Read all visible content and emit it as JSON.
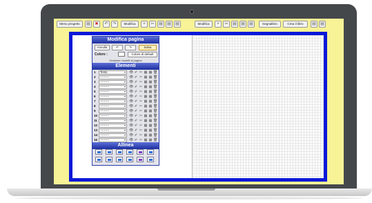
{
  "toolbar": {
    "menu_label": "Menu progetto",
    "modifica_left": "Modifica",
    "modifica_right": "Modifica",
    "segnalibro": "Segnalibro",
    "crea_libro": "Crea il libro",
    "undo_icon": "↶",
    "redo_icon": "↷",
    "cut_icon": "✂",
    "delete_icon": "✖",
    "image_icon": "▤",
    "plus_icon": "+"
  },
  "panel": {
    "title": "Modifica pagina",
    "annulla": "Annulla",
    "undo_icon": "↶",
    "redo_icon": "↷",
    "salva": "Salva",
    "colore_label": "Colore :",
    "colore_default": "Colore di default",
    "gestione": "Gestione modelli di pagina",
    "elementi_title": "Elementi",
    "allinea_title": "Allinea"
  },
  "rows": [
    {
      "num": "1",
      "value": "Testo"
    },
    {
      "num": "2",
      "value": "---------"
    },
    {
      "num": "3",
      "value": "---------"
    },
    {
      "num": "4",
      "value": "---------"
    },
    {
      "num": "5",
      "value": "---------"
    },
    {
      "num": "6",
      "value": "---------"
    },
    {
      "num": "7",
      "value": "---------"
    },
    {
      "num": "8",
      "value": "---------"
    },
    {
      "num": "9",
      "value": "---------"
    },
    {
      "num": "10",
      "value": "---------"
    },
    {
      "num": "11",
      "value": "---------"
    },
    {
      "num": "12",
      "value": "---------"
    },
    {
      "num": "13",
      "value": "---------"
    },
    {
      "num": "14",
      "value": "---------"
    },
    {
      "num": "15",
      "value": "---------"
    }
  ],
  "row_icons": [
    "👁",
    "✐",
    "✂",
    "▦",
    "▦",
    "🗑"
  ],
  "colors": {
    "frame": "#0a18d8",
    "screen": "#f7f396",
    "panel_title": "#1d2f9f"
  }
}
